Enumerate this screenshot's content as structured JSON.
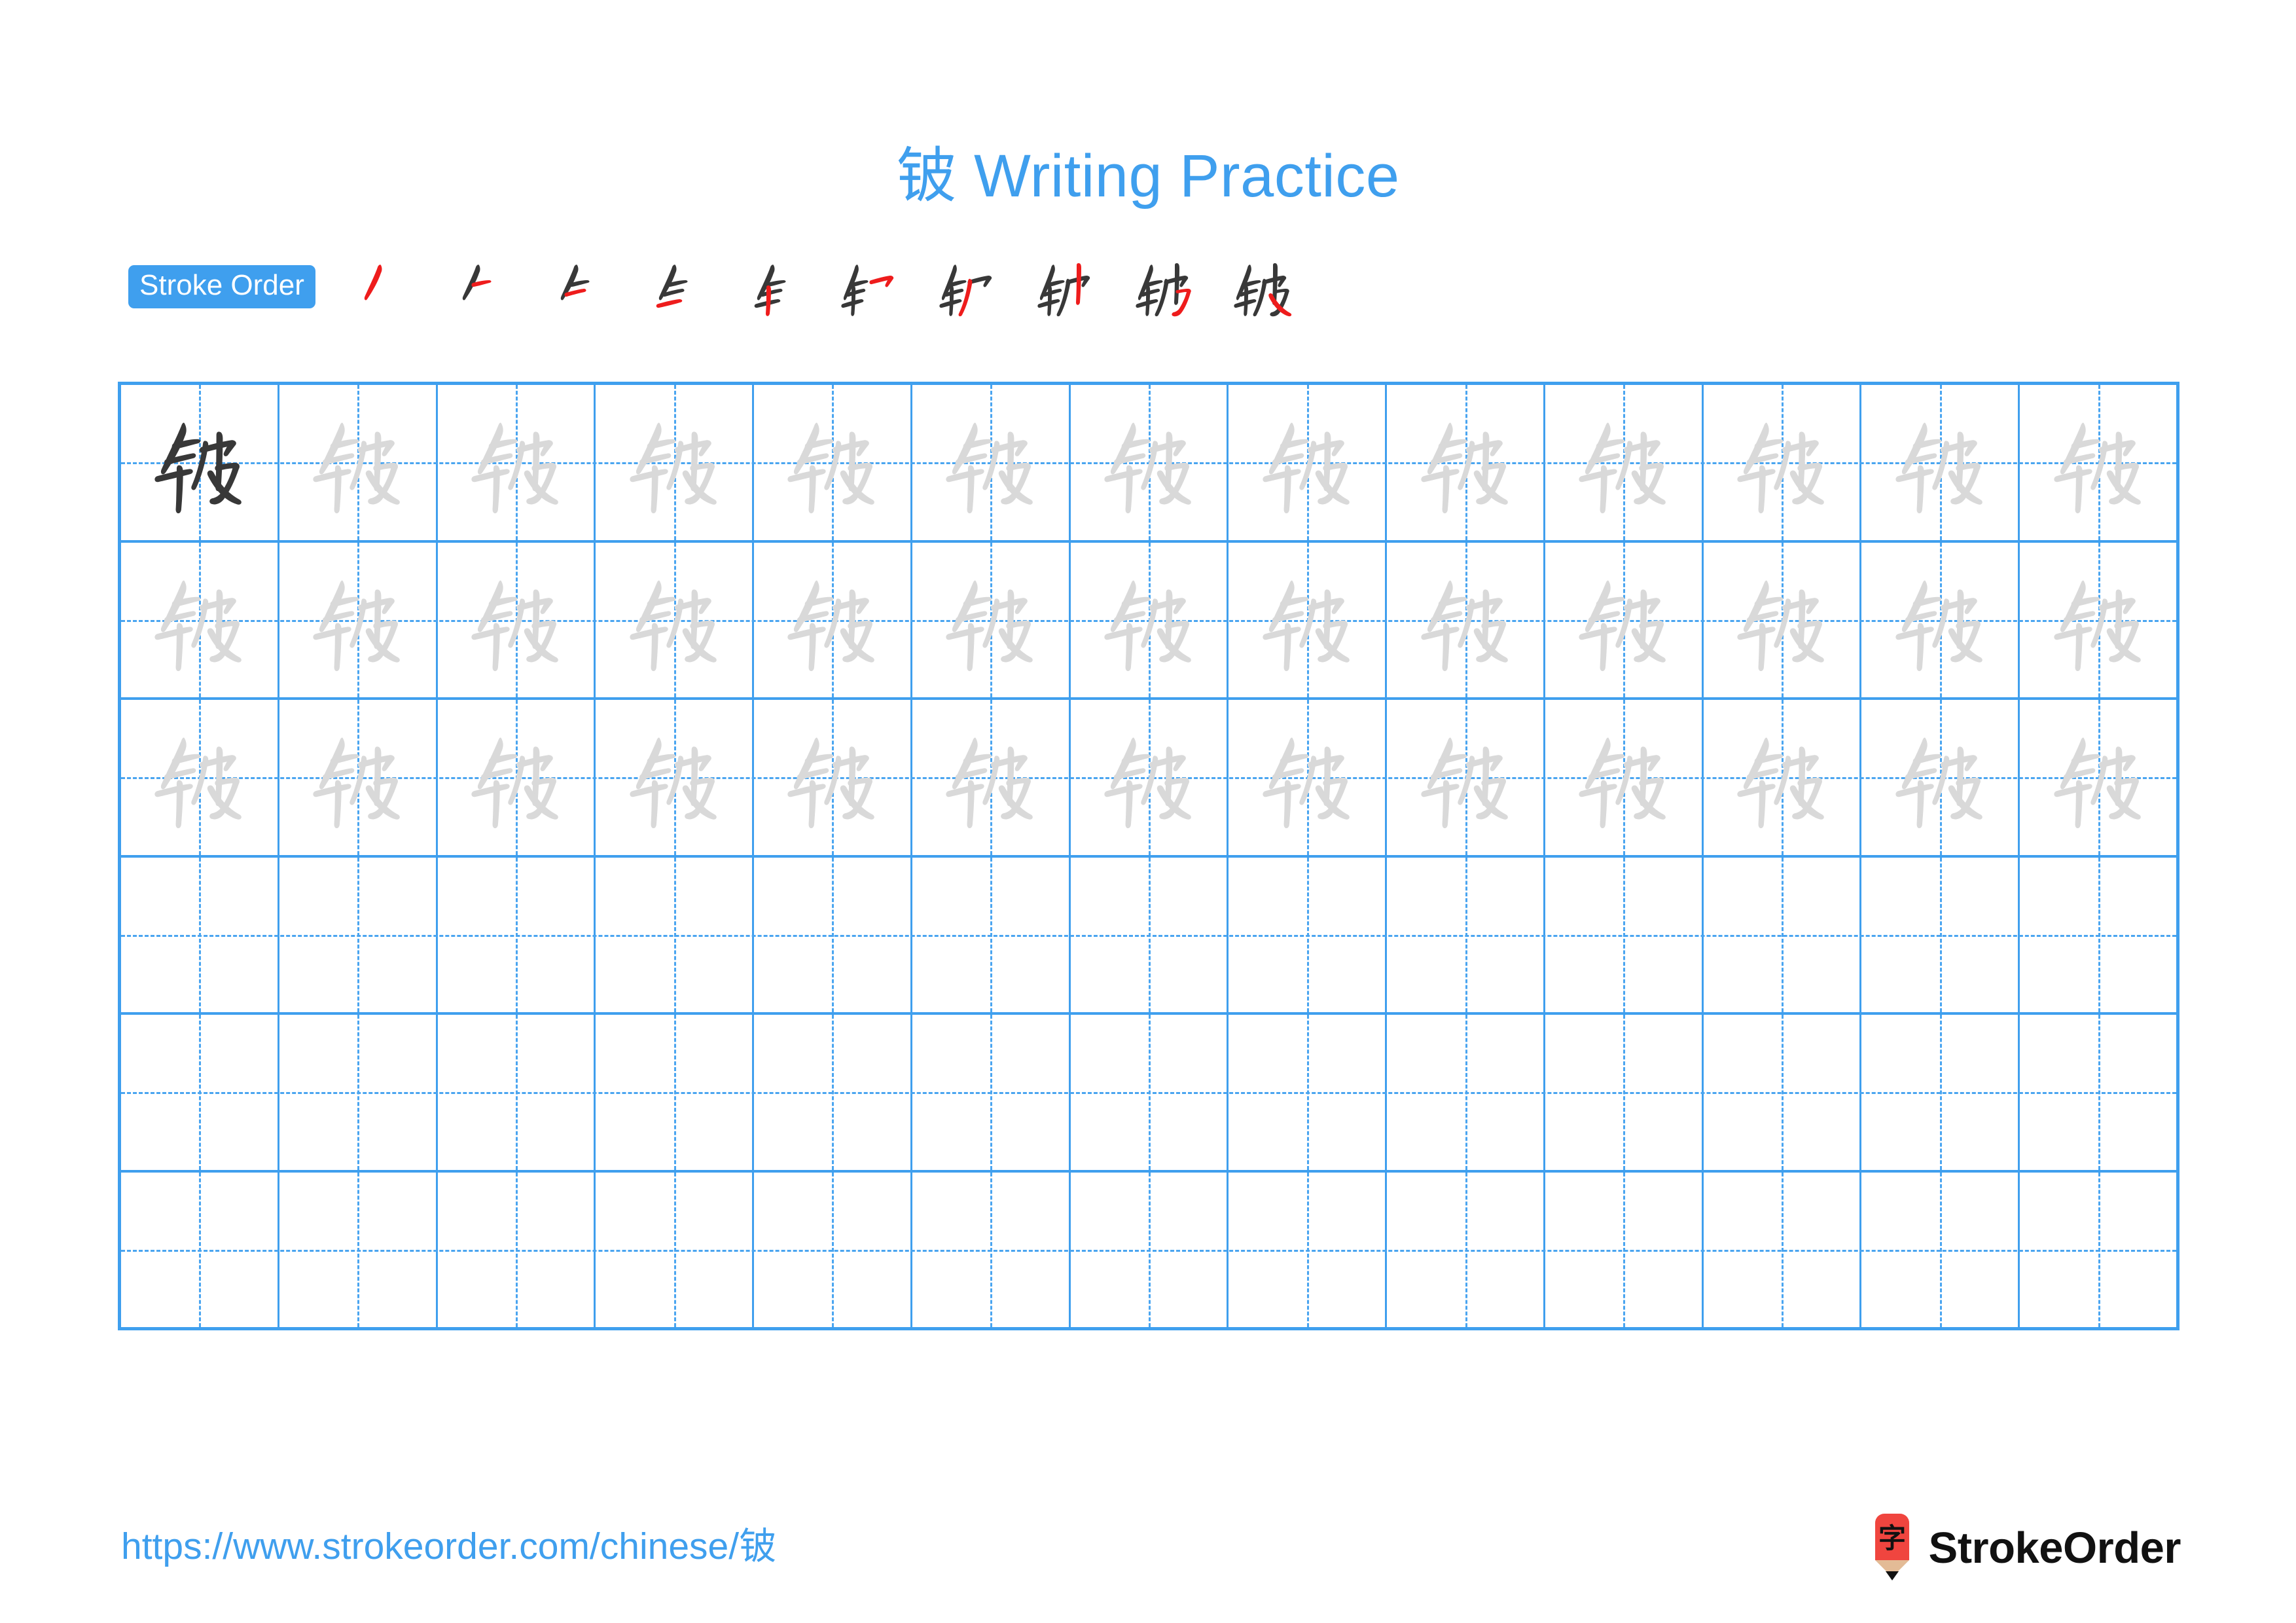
{
  "page": {
    "character": "铍",
    "title": "铍 Writing Practice",
    "title_color": "#3f9fee",
    "background_color": "#ffffff"
  },
  "stroke_order": {
    "badge_label": "Stroke Order",
    "badge_bg_color": "#3f9fee",
    "badge_text_color": "#ffffff",
    "total_strokes": 10,
    "new_stroke_color": "#ee1c1c",
    "existing_stroke_color": "#383838",
    "steps": [
      {
        "index": 1,
        "strokes_shown": 1,
        "new_stroke": 1
      },
      {
        "index": 2,
        "strokes_shown": 2,
        "new_stroke": 2
      },
      {
        "index": 3,
        "strokes_shown": 3,
        "new_stroke": 3
      },
      {
        "index": 4,
        "strokes_shown": 4,
        "new_stroke": 4
      },
      {
        "index": 5,
        "strokes_shown": 5,
        "new_stroke": 5
      },
      {
        "index": 6,
        "strokes_shown": 6,
        "new_stroke": 6
      },
      {
        "index": 7,
        "strokes_shown": 7,
        "new_stroke": 7
      },
      {
        "index": 8,
        "strokes_shown": 8,
        "new_stroke": 8
      },
      {
        "index": 9,
        "strokes_shown": 9,
        "new_stroke": 9
      },
      {
        "index": 10,
        "strokes_shown": 10,
        "new_stroke": 10
      }
    ]
  },
  "grid": {
    "columns": 13,
    "rows": 6,
    "line_color": "#3f9fee",
    "guide_line_color": "#4aa5f0",
    "model_character_color": "#383838",
    "trace_character_color": "#d9d9d9",
    "row_contents": [
      [
        "model",
        "trace",
        "trace",
        "trace",
        "trace",
        "trace",
        "trace",
        "trace",
        "trace",
        "trace",
        "trace",
        "trace",
        "trace"
      ],
      [
        "trace",
        "trace",
        "trace",
        "trace",
        "trace",
        "trace",
        "trace",
        "trace",
        "trace",
        "trace",
        "trace",
        "trace",
        "trace"
      ],
      [
        "trace",
        "trace",
        "trace",
        "trace",
        "trace",
        "trace",
        "trace",
        "trace",
        "trace",
        "trace",
        "trace",
        "trace",
        "trace"
      ],
      [
        "empty",
        "empty",
        "empty",
        "empty",
        "empty",
        "empty",
        "empty",
        "empty",
        "empty",
        "empty",
        "empty",
        "empty",
        "empty"
      ],
      [
        "empty",
        "empty",
        "empty",
        "empty",
        "empty",
        "empty",
        "empty",
        "empty",
        "empty",
        "empty",
        "empty",
        "empty",
        "empty"
      ],
      [
        "empty",
        "empty",
        "empty",
        "empty",
        "empty",
        "empty",
        "empty",
        "empty",
        "empty",
        "empty",
        "empty",
        "empty",
        "empty"
      ]
    ]
  },
  "footer": {
    "url": "https://www.strokeorder.com/chinese/铍",
    "url_color": "#3f9fee",
    "brand_name": "StrokeOrder",
    "brand_text_color": "#111111",
    "logo_character": "字",
    "logo_body_color": "#f0453f",
    "logo_wood_color": "#e3bb96",
    "logo_tip_color": "#111111"
  }
}
